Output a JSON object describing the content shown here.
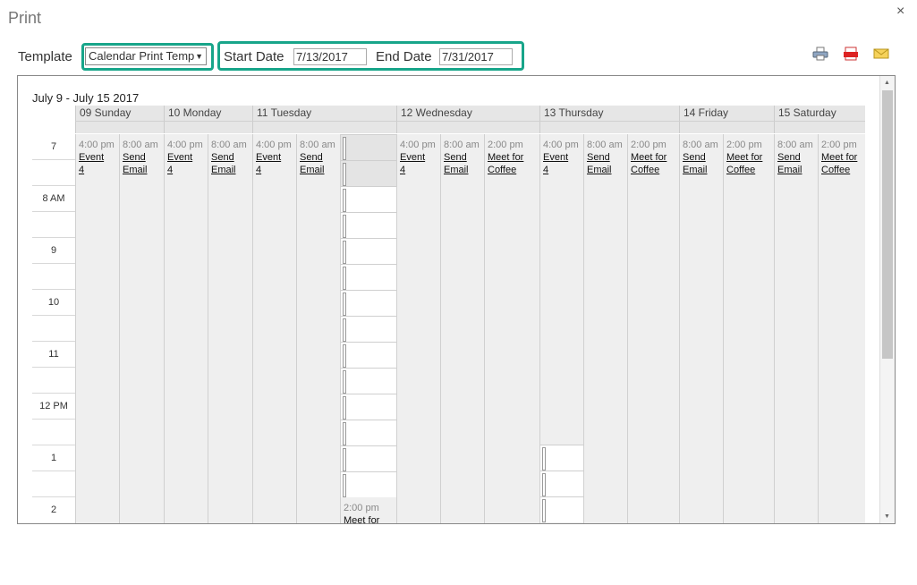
{
  "dialog": {
    "title": "Print",
    "close_icon": "×"
  },
  "toolbar": {
    "template_label": "Template",
    "template_value": "Calendar Print Temp",
    "start_label": "Start Date",
    "start_value": "7/13/2017",
    "end_label": "End Date",
    "end_value": "7/31/2017",
    "icons": [
      "printer-icon",
      "pdf-icon",
      "email-icon"
    ],
    "highlight_color": "#18a58a"
  },
  "calendar": {
    "week_title": "July 9 - July 15 2017",
    "hours": [
      "7",
      "8 AM",
      "9",
      "10",
      "11",
      "12 PM",
      "1",
      "2"
    ],
    "days": [
      "09 Sunday",
      "10 Monday",
      "11 Tuesday",
      "12 Wednesday",
      "13 Thursday",
      "14 Friday",
      "15 Saturday"
    ],
    "events": [
      {
        "time": "4:00 pm",
        "name1": "Event",
        "name2": "4"
      },
      {
        "time": "8:00 am",
        "name1": "Send",
        "name2": "Email"
      },
      {
        "time": "4:00 pm",
        "name1": "Event",
        "name2": "4"
      },
      {
        "time": "8:00 am",
        "name1": "Send",
        "name2": "Email"
      },
      {
        "time": "4:00 pm",
        "name1": "Event",
        "name2": "4"
      },
      {
        "time": "8:00 am",
        "name1": "Send",
        "name2": "Email"
      },
      {
        "time": "2:00 pm",
        "name1": "Meet for",
        "name2": ""
      },
      {
        "time": "4:00 pm",
        "name1": "Event",
        "name2": "4"
      },
      {
        "time": "8:00 am",
        "name1": "Send",
        "name2": "Email"
      },
      {
        "time": "2:00 pm",
        "name1": "Meet for",
        "name2": "Coffee"
      },
      {
        "time": "4:00 pm",
        "name1": "Event",
        "name2": "4"
      },
      {
        "time": "8:00 am",
        "name1": "Send",
        "name2": "Email"
      },
      {
        "time": "2:00 pm",
        "name1": "Meet for",
        "name2": "Coffee"
      },
      {
        "time": "8:00 am",
        "name1": "Send",
        "name2": "Email"
      },
      {
        "time": "2:00 pm",
        "name1": "Meet for",
        "name2": "Coffee"
      },
      {
        "time": "8:00 am",
        "name1": "Send",
        "name2": "Email"
      },
      {
        "time": "2:00 pm",
        "name1": "Meet for",
        "name2": "Coffee"
      }
    ]
  }
}
